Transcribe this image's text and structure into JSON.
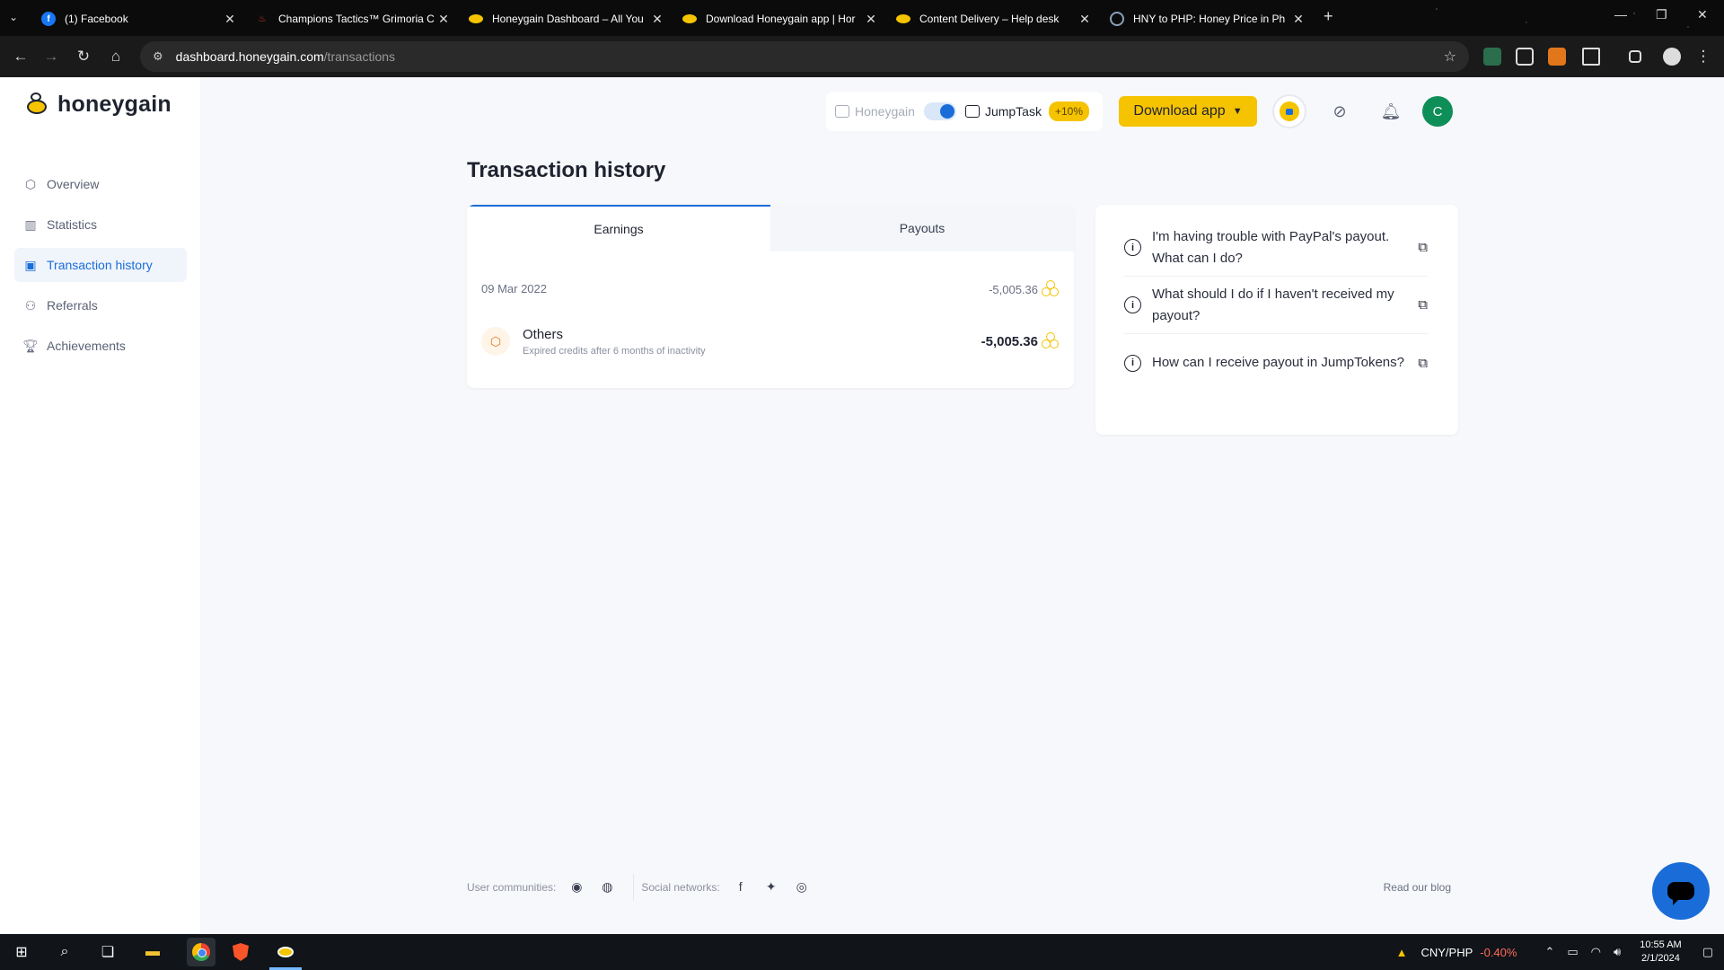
{
  "browser": {
    "tabs": [
      {
        "title": "(1) Facebook",
        "favicon": "facebook-icon",
        "color": "#1877f2"
      },
      {
        "title": "Champions Tactics™ Grimoria C",
        "favicon": "flame-icon",
        "color": "#e0442b"
      },
      {
        "title": "Honeygain Dashboard – All You",
        "favicon": "honeygain-icon",
        "color": "#f5c300"
      },
      {
        "title": "Download Honeygain app | Hor",
        "favicon": "honeygain-icon",
        "color": "#f5c300"
      },
      {
        "title": "Content Delivery – Help desk",
        "favicon": "honeygain-icon",
        "color": "#f5c300"
      },
      {
        "title": "HNY to PHP: Honey Price in Ph",
        "favicon": "coin-icon",
        "color": "#8aa0b8"
      }
    ],
    "url_host": "dashboard.honeygain.com",
    "url_path": "/transactions"
  },
  "sidebar": {
    "logo_text": "honeygain",
    "items": [
      {
        "label": "Overview",
        "icon": "hexagon-icon"
      },
      {
        "label": "Statistics",
        "icon": "chart-icon"
      },
      {
        "label": "Transaction history",
        "icon": "wallet-icon",
        "active": true
      },
      {
        "label": "Referrals",
        "icon": "users-icon"
      },
      {
        "label": "Achievements",
        "icon": "trophy-icon"
      }
    ]
  },
  "header": {
    "toggle_left": "Honeygain",
    "toggle_right": "JumpTask",
    "bonus": "+10%",
    "download_label": "Download app",
    "avatar_initial": "C"
  },
  "main": {
    "title": "Transaction history",
    "tabs": [
      "Earnings",
      "Payouts"
    ],
    "group_date": "09 Mar 2022",
    "group_total": "-5,005.36",
    "transaction": {
      "name": "Others",
      "description": "Expired credits after 6 months of inactivity",
      "amount": "-5,005.36"
    }
  },
  "faq": [
    "I'm having trouble with PayPal's payout. What can I do?",
    "What should I do if I haven't received my payout?",
    "How can I receive payout in JumpTokens?"
  ],
  "footer": {
    "communities_label": "User communities:",
    "social_label": "Social networks:",
    "blog_label": "Read our blog"
  },
  "taskbar": {
    "ticker": "CNY/PHP",
    "ticker_change": "-0.40%",
    "time": "10:55 AM",
    "date": "2/1/2024"
  },
  "colors": {
    "brand": "#f5c300",
    "accent": "#1a6dd8",
    "negative": "#ff6b5a"
  }
}
